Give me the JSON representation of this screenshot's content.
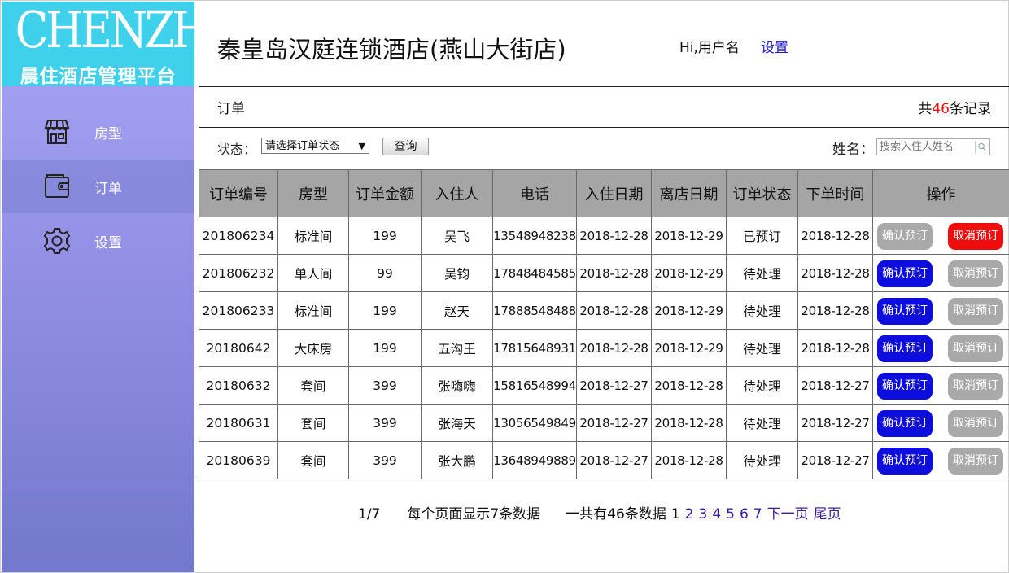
{
  "logo": {
    "brand": "CHENZHU",
    "tagline": "晨住酒店管理平台"
  },
  "sidebar": {
    "items": [
      {
        "label": "房型",
        "icon": "store-icon",
        "active": false
      },
      {
        "label": "订单",
        "icon": "wallet-icon",
        "active": true
      },
      {
        "label": "设置",
        "icon": "gear-icon",
        "active": false
      }
    ]
  },
  "header": {
    "title": "秦皇岛汉庭连锁酒店(燕山大街店)",
    "greeting": "Hi,用户名",
    "settings_link": "设置"
  },
  "section": {
    "title": "订单",
    "count_prefix": "共",
    "count_value": "46",
    "count_suffix": "条记录"
  },
  "filters": {
    "status_label": "状态：",
    "status_selected": "请选择订单状态",
    "query_button": "查询",
    "name_label": "姓名：",
    "name_placeholder": "搜索入住人姓名"
  },
  "table": {
    "columns": [
      "订单编号",
      "房型",
      "订单金额",
      "入住人",
      "电话",
      "入住日期",
      "离店日期",
      "订单状态",
      "下单时间",
      "操作"
    ],
    "confirm_label": "确认预订",
    "cancel_label": "取消预订",
    "rows": [
      {
        "id": "201806234",
        "room": "标准间",
        "amount": "199",
        "guest": "吴飞",
        "phone": "13548948238",
        "checkin": "2018-12-28",
        "checkout": "2018-12-29",
        "status": "已预订",
        "ordered": "2018-12-28",
        "confirm_state": "disabled",
        "cancel_state": "active"
      },
      {
        "id": "201806232",
        "room": "单人间",
        "amount": "99",
        "guest": "吴钧",
        "phone": "17848484585",
        "checkin": "2018-12-28",
        "checkout": "2018-12-29",
        "status": "待处理",
        "ordered": "2018-12-28",
        "confirm_state": "active",
        "cancel_state": "disabled"
      },
      {
        "id": "201806233",
        "room": "标准间",
        "amount": "199",
        "guest": "赵天",
        "phone": "17888548488",
        "checkin": "2018-12-28",
        "checkout": "2018-12-29",
        "status": "待处理",
        "ordered": "2018-12-28",
        "confirm_state": "active",
        "cancel_state": "disabled"
      },
      {
        "id": "20180642",
        "room": "大床房",
        "amount": "199",
        "guest": "五沟王",
        "phone": "17815648931",
        "checkin": "2018-12-28",
        "checkout": "2018-12-29",
        "status": "待处理",
        "ordered": "2018-12-28",
        "confirm_state": "active",
        "cancel_state": "disabled"
      },
      {
        "id": "20180632",
        "room": "套间",
        "amount": "399",
        "guest": "张嗨嗨",
        "phone": "15816548994",
        "checkin": "2018-12-27",
        "checkout": "2018-12-28",
        "status": "待处理",
        "ordered": "2018-12-27",
        "confirm_state": "active",
        "cancel_state": "disabled"
      },
      {
        "id": "20180631",
        "room": "套间",
        "amount": "399",
        "guest": "张海天",
        "phone": "13056549849",
        "checkin": "2018-12-27",
        "checkout": "2018-12-28",
        "status": "待处理",
        "ordered": "2018-12-27",
        "confirm_state": "active",
        "cancel_state": "disabled"
      },
      {
        "id": "20180639",
        "room": "套间",
        "amount": "399",
        "guest": "张大鹏",
        "phone": "13648949889",
        "checkin": "2018-12-27",
        "checkout": "2018-12-28",
        "status": "待处理",
        "ordered": "2018-12-27",
        "confirm_state": "active",
        "cancel_state": "disabled"
      }
    ]
  },
  "pagination": {
    "page_indicator": "1/7",
    "per_page_text": "每个页面显示7条数据",
    "total_text": "一共有46条数据",
    "current_page": "1",
    "pages": [
      "2",
      "3",
      "4",
      "5",
      "6",
      "7"
    ],
    "next_label": "下一页",
    "last_label": "尾页"
  },
  "colors": {
    "logo_bg": "#3fd0ec",
    "sidebar_top": "#a29ef0",
    "sidebar_bottom": "#7278cc",
    "header_cell_bg": "#a5a5a5",
    "button_blue": "#0d0ddd",
    "button_gray": "#a9a9a9",
    "button_red": "#ee0c0c",
    "count_red": "#e01010",
    "link_blue": "#1a1ad6",
    "page_link": "#3a1b99"
  }
}
